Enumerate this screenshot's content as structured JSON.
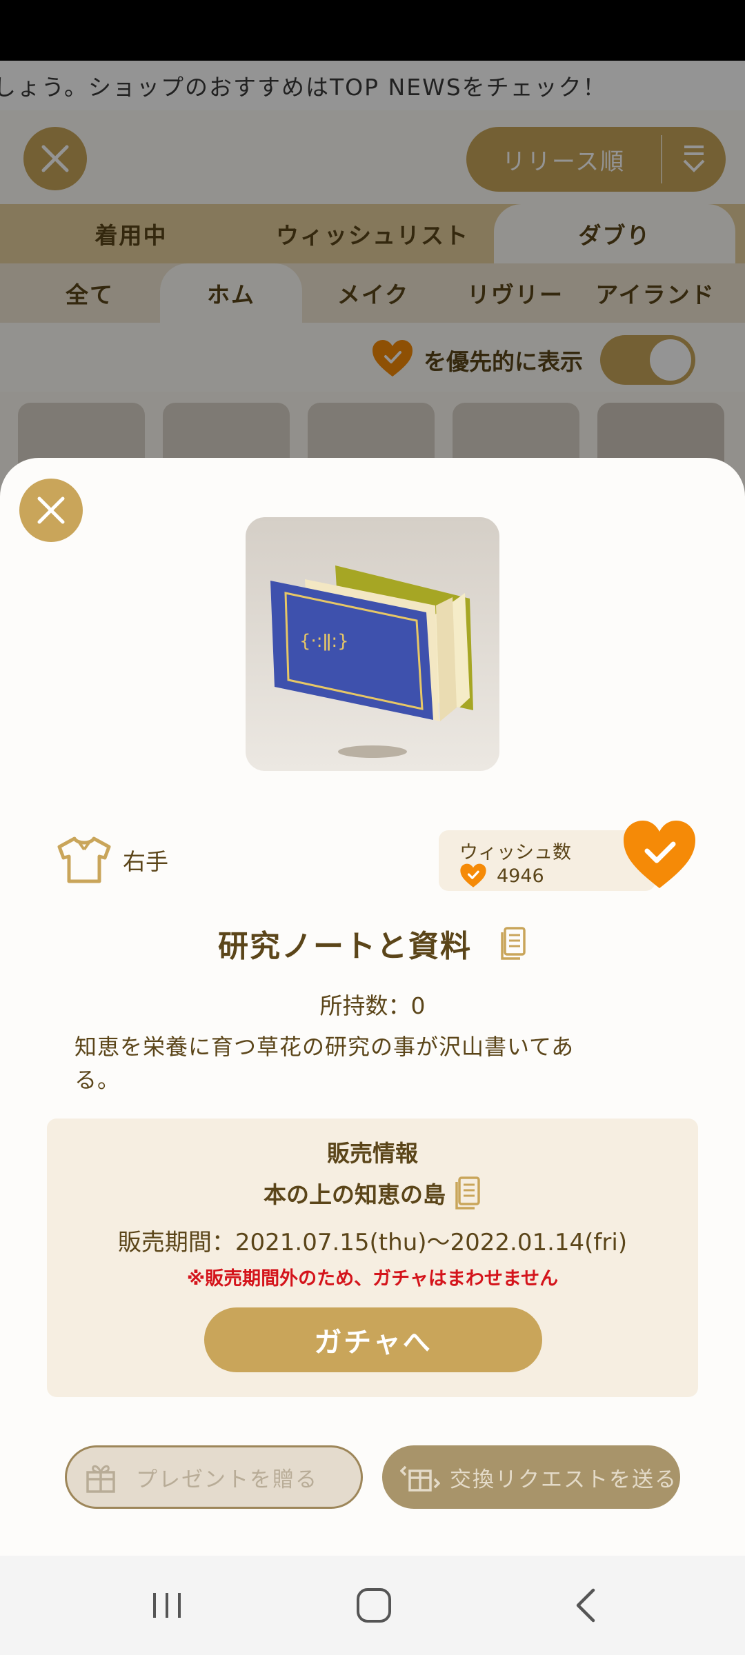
{
  "ticker": {
    "text": "しょう。ショップのおすすめはTOP NEWSをチェック！"
  },
  "header": {
    "sort_label": "リリース順"
  },
  "tabs": [
    "着用中",
    "ウィッシュリスト",
    "ダブり"
  ],
  "subtabs": [
    "全て",
    "ホム",
    "メイク",
    "リヴリー",
    "アイランド"
  ],
  "filter": {
    "label": "を優先的に表示"
  },
  "item": {
    "slot": "右手",
    "wish_title": "ウィッシュ数",
    "wish_count": "4946",
    "name": "研究ノートと資料",
    "owned": "所持数：0",
    "description": "知恵を栄養に育つ草花の研究の事が沢山書いてある。"
  },
  "sale": {
    "title": "販売情報",
    "gacha_name": "本の上の知恵の島",
    "period": "販売期間：2021.07.15(thu)〜2022.01.14(fri)",
    "warning": "※販売期間外のため、ガチャはまわせません",
    "button": "ガチャへ"
  },
  "actions": {
    "present": "プレゼントを贈る",
    "trade": "交換リクエストを送る"
  },
  "colors": {
    "accent_gold": "#c9a55a",
    "text_brown": "#5b4519",
    "wish_orange": "#f58a07",
    "warning_red": "#d4141b",
    "panel_beige": "#f6eee1"
  },
  "icons": [
    "close-icon",
    "sort-icon",
    "heart-check-icon",
    "shirt-icon",
    "document-icon",
    "gift-icon",
    "trade-icon",
    "recents-icon",
    "home-icon",
    "back-icon"
  ]
}
